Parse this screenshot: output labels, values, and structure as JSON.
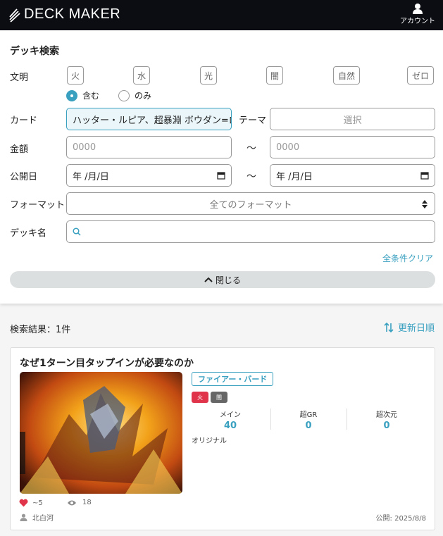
{
  "header": {
    "logo_text": "DECK MAKER",
    "account_label": "アカウント",
    "colors": {
      "background": "#0b0d12"
    }
  },
  "search": {
    "title": "デッキ検索",
    "labels": {
      "civilization": "文明",
      "card": "カード",
      "theme": "テーマ",
      "price": "金額",
      "published": "公開日",
      "format": "フォーマット",
      "deck_name": "デッキ名"
    },
    "civilizations": [
      "火",
      "水",
      "光",
      "闇",
      "自然",
      "ゼロ"
    ],
    "civ_mode": {
      "include": "含む",
      "only": "のみ",
      "selected": "include"
    },
    "card_value": "ハッター・ルピア、超暴淵 ボウダン=ロ'",
    "theme_placeholder": "選択",
    "price_min_placeholder": "0000",
    "price_max_placeholder": "0000",
    "range_sep": "〜",
    "date_from": "年 /月/日",
    "date_to": "年 /月/日",
    "format_value": "全てのフォーマット",
    "deck_name_value": "",
    "clear_all": "全条件クリア",
    "close_label": "閉じる"
  },
  "results": {
    "summary": "検索結果：1件",
    "sort_label": "更新日順",
    "items": [
      {
        "title": "なぜ1ターン目タップインが必要なのか",
        "theme": "ファイアー・バード",
        "civs": [
          {
            "label": "火",
            "color": "#e0344a"
          },
          {
            "label": "闇",
            "color": "#666666"
          }
        ],
        "stats": [
          {
            "label": "メイン",
            "value": "40"
          },
          {
            "label": "超GR",
            "value": "0"
          },
          {
            "label": "超次元",
            "value": "0"
          }
        ],
        "type": "オリジナル",
        "likes": "~5",
        "views": "18",
        "author": "北白河",
        "published": "公開: 2025/8/8"
      }
    ]
  },
  "colors": {
    "accent": "#3aa0c0",
    "like": "#e0344a"
  }
}
